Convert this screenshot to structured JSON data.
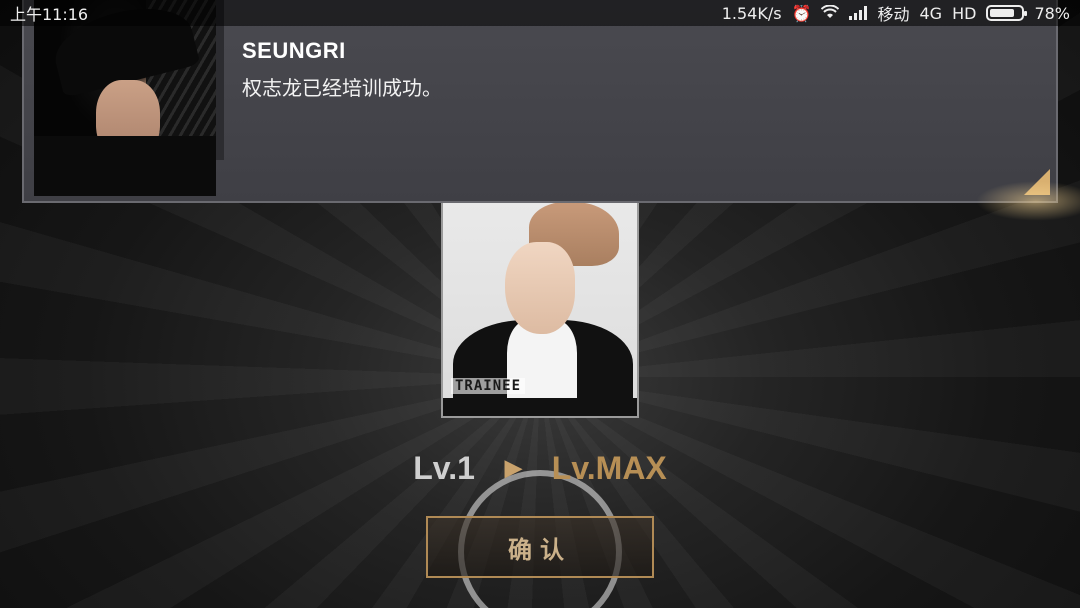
{
  "status_bar": {
    "time": "上午11:16",
    "speed": "1.54K/s",
    "alarm_icon": "alarm-clock-icon",
    "wifi_icon": "wifi-icon",
    "signal_icon": "cell-signal-icon",
    "carrier": "移动",
    "network": "4G",
    "hd": "HD",
    "battery_level": 0.78,
    "battery_text": "78%"
  },
  "notification": {
    "name": "SEUNGRI",
    "message": "权志龙已经培训成功。",
    "accent_color": "#d9b070"
  },
  "card": {
    "badge": "TRAINEE"
  },
  "levels": {
    "from": "Lv.1",
    "arrow": "▶",
    "to": "Lv.MAX"
  },
  "confirm": {
    "label": "确认"
  }
}
